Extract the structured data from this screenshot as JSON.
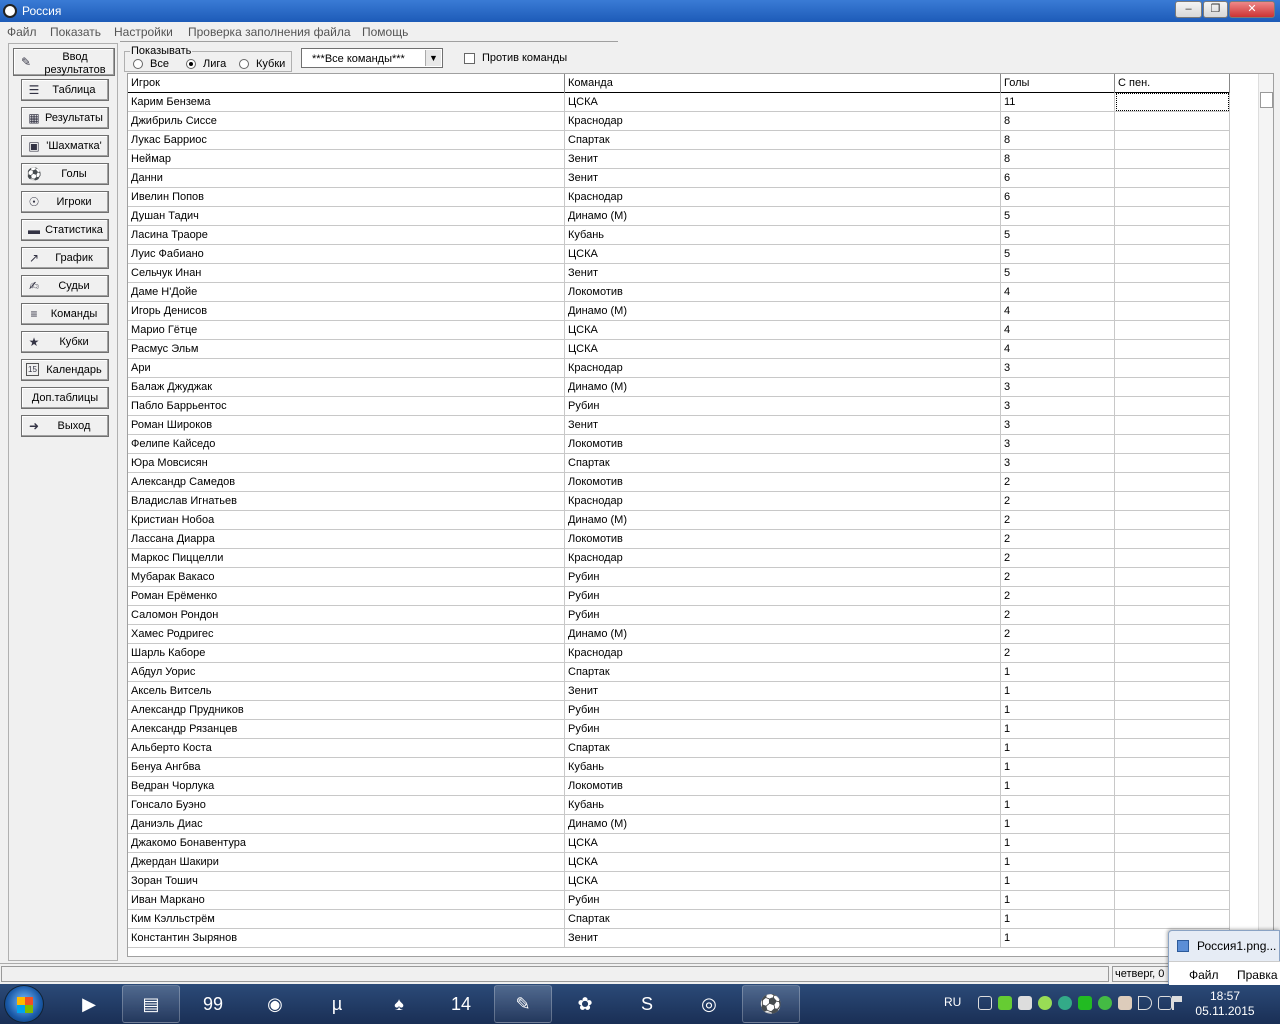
{
  "window": {
    "title": "Россия"
  },
  "menu": [
    "Файл",
    "Показать",
    "Настройки",
    "Проверка заполнения файла",
    "Помощь"
  ],
  "nav": [
    {
      "label": "Ввод результатов",
      "icon": "pencil-edit-icon"
    },
    {
      "label": "Таблица",
      "icon": "list-icon"
    },
    {
      "label": "Результаты",
      "icon": "results-table-icon"
    },
    {
      "label": "'Шахматка'",
      "icon": "chessboard-icon"
    },
    {
      "label": "Голы",
      "icon": "football-ball-icon"
    },
    {
      "label": "Игроки",
      "icon": "player-icon"
    },
    {
      "label": "Статистика",
      "icon": "ruler-stats-icon"
    },
    {
      "label": "График",
      "icon": "line-graph-icon"
    },
    {
      "label": "Судьи",
      "icon": "referee-notepad-icon"
    },
    {
      "label": "Команды",
      "icon": "teams-list-icon"
    },
    {
      "label": "Кубки",
      "icon": "cup-icon"
    },
    {
      "label": "Календарь",
      "icon": "calendar-icon"
    },
    {
      "label": "Доп.таблицы",
      "icon": ""
    },
    {
      "label": "Выход",
      "icon": "exit-door-icon"
    }
  ],
  "filter": {
    "caption": "Показывать",
    "options": [
      "Все",
      "Лига",
      "Кубки"
    ],
    "selected": "Лига",
    "team_select": "***Все команды***",
    "against_label": "Против команды",
    "against_checked": false
  },
  "grid": {
    "columns": [
      "Игрок",
      "Команда",
      "Голы",
      "С пен."
    ],
    "rows": [
      [
        "Карим Бензема",
        "ЦСКА",
        "11",
        ""
      ],
      [
        "Джибриль Сиссе",
        "Краснодар",
        "8",
        ""
      ],
      [
        "Лукас Барриос",
        "Спартак",
        "8",
        ""
      ],
      [
        "Неймар",
        "Зенит",
        "8",
        ""
      ],
      [
        "Данни",
        "Зенит",
        "6",
        ""
      ],
      [
        "Ивелин Попов",
        "Краснодар",
        "6",
        ""
      ],
      [
        "Душан Тадич",
        "Динамо (М)",
        "5",
        ""
      ],
      [
        "Ласина Траоре",
        "Кубань",
        "5",
        ""
      ],
      [
        "Луис Фабиано",
        "ЦСКА",
        "5",
        ""
      ],
      [
        "Сельчук Инан",
        "Зенит",
        "5",
        ""
      ],
      [
        "Даме Н'Дойе",
        "Локомотив",
        "4",
        ""
      ],
      [
        "Игорь Денисов",
        "Динамо (М)",
        "4",
        ""
      ],
      [
        "Марио Гётце",
        "ЦСКА",
        "4",
        ""
      ],
      [
        "Расмус Эльм",
        "ЦСКА",
        "4",
        ""
      ],
      [
        "Ари",
        "Краснодар",
        "3",
        ""
      ],
      [
        "Балаж Джуджак",
        "Динамо (М)",
        "3",
        ""
      ],
      [
        "Пабло Баррьентос",
        "Рубин",
        "3",
        ""
      ],
      [
        "Роман Широков",
        "Зенит",
        "3",
        ""
      ],
      [
        "Фелипе Кайседо",
        "Локомотив",
        "3",
        ""
      ],
      [
        "Юра Мовсисян",
        "Спартак",
        "3",
        ""
      ],
      [
        "Александр Самедов",
        "Локомотив",
        "2",
        ""
      ],
      [
        "Владислав Игнатьев",
        "Краснодар",
        "2",
        ""
      ],
      [
        "Кристиан Нобоа",
        "Динамо (М)",
        "2",
        ""
      ],
      [
        "Лассана Диарра",
        "Локомотив",
        "2",
        ""
      ],
      [
        "Маркос Пиццелли",
        "Краснодар",
        "2",
        ""
      ],
      [
        "Мубарак Вакасо",
        "Рубин",
        "2",
        ""
      ],
      [
        "Роман Ерёменко",
        "Рубин",
        "2",
        ""
      ],
      [
        "Саломон Рондон",
        "Рубин",
        "2",
        ""
      ],
      [
        "Хамес Родригес",
        "Динамо (М)",
        "2",
        ""
      ],
      [
        "Шарль Каборе",
        "Краснодар",
        "2",
        ""
      ],
      [
        "Абдул Уорис",
        "Спартак",
        "1",
        ""
      ],
      [
        "Аксель Витсель",
        "Зенит",
        "1",
        ""
      ],
      [
        "Александр Прудников",
        "Рубин",
        "1",
        ""
      ],
      [
        "Александр Рязанцев",
        "Рубин",
        "1",
        ""
      ],
      [
        "Альберто Коста",
        "Спартак",
        "1",
        ""
      ],
      [
        "Бенуа Ангбва",
        "Кубань",
        "1",
        ""
      ],
      [
        "Ведран Чорлука",
        "Локомотив",
        "1",
        ""
      ],
      [
        "Гонсало Буэно",
        "Кубань",
        "1",
        ""
      ],
      [
        "Даниэль Диас",
        "Динамо (М)",
        "1",
        ""
      ],
      [
        "Джакомо Бонавентура",
        "ЦСКА",
        "1",
        ""
      ],
      [
        "Джердан Шакири",
        "ЦСКА",
        "1",
        ""
      ],
      [
        "Зоран Тошич",
        "ЦСКА",
        "1",
        ""
      ],
      [
        "Иван Маркано",
        "Рубин",
        "1",
        ""
      ],
      [
        "Ким Кэлльстрём",
        "Спартак",
        "1",
        ""
      ],
      [
        "Константин Зырянов",
        "Зенит",
        "1",
        ""
      ]
    ]
  },
  "status": {
    "date_text": "четверг, 0"
  },
  "taskbar": {
    "apps": [
      {
        "name": "media-player-icon",
        "glyph": "▶"
      },
      {
        "name": "file-explorer-icon",
        "glyph": "▤"
      },
      {
        "name": "monitor-99-icon",
        "glyph": "99"
      },
      {
        "name": "camera-icon",
        "glyph": "◉"
      },
      {
        "name": "utorrent-icon",
        "glyph": "µ"
      },
      {
        "name": "cards-game-icon",
        "glyph": "♠"
      },
      {
        "name": "app-14-icon",
        "glyph": "14"
      },
      {
        "name": "editor-icon",
        "glyph": "✎"
      },
      {
        "name": "icq-icon",
        "glyph": "✿"
      },
      {
        "name": "skype-icon",
        "glyph": "S"
      },
      {
        "name": "chrome-icon",
        "glyph": "◎"
      },
      {
        "name": "football-app-icon",
        "glyph": "⚽"
      }
    ],
    "lang": "RU",
    "time": "18:57",
    "date": "05.11.2015"
  },
  "preview": {
    "title": "Россия1.png...",
    "menu": [
      "Файл",
      "Правка"
    ]
  },
  "colors": {
    "title_bar": "#1d5bb8",
    "taskbar": "#1a2f55",
    "grid_bg": "#ffffff"
  }
}
